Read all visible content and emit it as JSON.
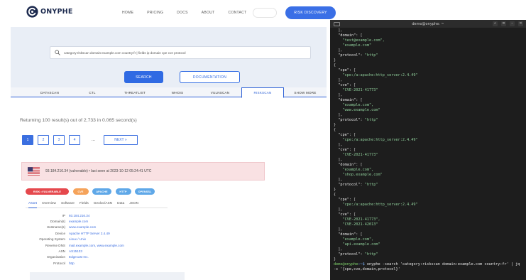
{
  "header": {
    "logo_text": "ONYPHE",
    "nav": [
      "HOME",
      "PRICING",
      "DOCS",
      "ABOUT",
      "CONTACT"
    ],
    "cta_label": "RISK DISCOVERY"
  },
  "search": {
    "query": "category:riskscan domain:example.com country:fr | fields ip domain cpe cve protocol",
    "search_label": "SEARCH",
    "docs_label": "DOCUMENTATION"
  },
  "categories": {
    "tabs": [
      "DATASCAN",
      "CTL",
      "THREATLIST",
      "WHOIS",
      "VULNSCAN",
      "RISKSCAN",
      "SHOW MORE"
    ],
    "active_index": 5
  },
  "results": {
    "summary": "Returning 100 result(s) out of 2,733 in 0.065 second(s)",
    "pages": [
      "1",
      "2",
      "3",
      "4"
    ],
    "current_page": "1",
    "ellipsis": "...",
    "next_label": "NEXT »"
  },
  "result_card": {
    "country_flag": "us-flag-icon",
    "title": "93.184.216.34 (vulnerable) • last seen at 2023-10-12 05:24:41 UTC",
    "tags": [
      {
        "label": "RISK::VULNERABLE",
        "color": "#e5484d"
      },
      {
        "label": "CVE",
        "color": "#f5a35a"
      },
      {
        "label": "APACHE",
        "color": "#5fa8e8"
      },
      {
        "label": "HTTP",
        "color": "#5fa8e8"
      },
      {
        "label": "OPENSSL",
        "color": "#5fa8e8"
      }
    ],
    "tabs": [
      "Asset",
      "Overview",
      "Software",
      "Fields",
      "Geoloc/ASN",
      "Data",
      "JSON"
    ],
    "active_tab": "Asset",
    "fields": [
      {
        "label": "IP",
        "value": "93.184.216.34"
      },
      {
        "label": "Domain(s)",
        "value": "example.com"
      },
      {
        "label": "Hostname(s)",
        "value": "www.example.com"
      },
      {
        "label": "Device",
        "value": "Apache HTTP Server 2.4.49"
      },
      {
        "label": "Operating System",
        "value": "Linux / Unix"
      },
      {
        "label": "Reverse DNS",
        "value": "mail.example.com, www.example.com"
      },
      {
        "label": "ASN",
        "value": "AS15133"
      },
      {
        "label": "Organization",
        "value": "Edgecast Inc."
      },
      {
        "label": "Protocol",
        "value": "http"
      }
    ]
  },
  "terminal": {
    "title": "demo@onyphe: ~",
    "lines": [
      "  ],",
      "  \"domain\": [",
      "    \"test@example.com\",",
      "    \"example.com\"",
      "  ],",
      "  \"protocol\": \"http\"",
      "}",
      "{",
      "  \"cpe\": [",
      "    \"cpe:/a:apache:http_server:2.4.49\"",
      "  ],",
      "  \"cve\": [",
      "    \"CVE-2021-41773\"",
      "  ],",
      "  \"domain\": [",
      "    \"example.com\",",
      "    \"www.example.com\"",
      "  ],",
      "  \"protocol\": \"http\"",
      "}",
      "{",
      "  \"cpe\": [",
      "    \"cpe:/a:apache:http_server:2.4.49\"",
      "  ],",
      "  \"cve\": [",
      "    \"CVE-2021-41773\"",
      "  ],",
      "  \"domain\": [",
      "    \"example.com\",",
      "    \"shop.example.com\"",
      "  ],",
      "  \"protocol\": \"http\"",
      "}",
      "{",
      "  \"cpe\": [",
      "    \"cpe:/a:apache:http_server:2.4.49\"",
      "  ],",
      "  \"cve\": [",
      "    \"CVE-2021-41773\",",
      "    \"CVE-2021-42013\"",
      "  ],",
      "  \"domain\": [",
      "    \"example.com\",",
      "    \"api.example.com\"",
      "  ],",
      "  \"protocol\": \"http\"",
      "}"
    ],
    "prompt_user": "demo@onyphe",
    "prompt_symbol": ":~$ ",
    "command": "onyphe -search 'category:riskscan domain:example.com country:fr' | jq -c '{cpe,cve,domain,protocol}'"
  },
  "colors": {
    "accent": "#3a6fe6",
    "hero_bg": "#e9eef6",
    "alert_bg": "#f9e1e3",
    "terminal_bg": "#1d1d1d"
  }
}
